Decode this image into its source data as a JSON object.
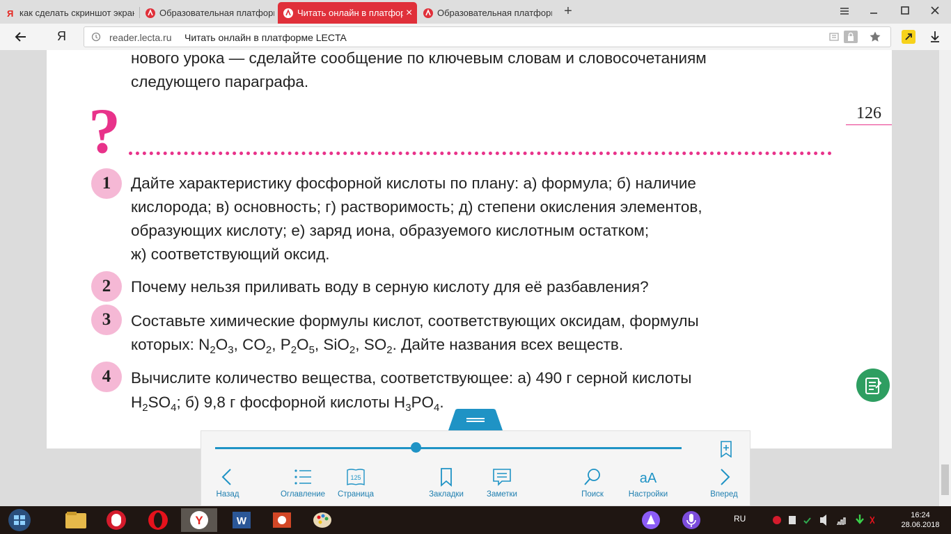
{
  "browser": {
    "tabs": [
      {
        "label": "как сделать скриншот экрана",
        "active": false
      },
      {
        "label": "Образовательная платформа",
        "active": false
      },
      {
        "label": "Читать онлайн в платформе",
        "active": true
      },
      {
        "label": "Образовательная платформа",
        "active": false
      }
    ],
    "back_icon": "arrow-left-icon",
    "yandex_logo": "Я",
    "url": "reader.lecta.ru",
    "page_title": "Читать онлайн в платформе LECTA"
  },
  "page": {
    "intro_line1": "нового урока — сделайте сообщение по ключевым словам и словосочетаниям",
    "intro_line2": "следующего параграфа.",
    "question_mark": "?",
    "page_number": "126",
    "questions": [
      {
        "num": "1",
        "lines": [
          "Дайте характеристику фосфорной кислоты по плану: а) формула; б) наличие",
          "кислорода; в) основность; г) растворимость; д) степени окисления элементов,",
          "образующих кислоту; е) заряд иона, образуемого кислотным остатком;",
          "ж) соответствующий оксид."
        ]
      },
      {
        "num": "2",
        "lines": [
          "Почему нельзя приливать воду в серную кислоту для её разбавления?"
        ]
      },
      {
        "num": "3",
        "line1": "Составьте химические формулы кислот, соответствующих оксидам, формулы",
        "line2_prefix": "которых: ",
        "formulas": [
          "N",
          "2",
          "O",
          "3",
          ", CO",
          "2",
          ", P",
          "2",
          "O",
          "5",
          ", SiO",
          "2",
          ", SO",
          "2"
        ],
        "line2_suffix": ". Дайте названия всех веществ."
      },
      {
        "num": "4",
        "line1": "Вычислите количество вещества, соответствующее: а) 490 г серной кислоты",
        "line2_parts": [
          "H",
          "2",
          "SO",
          "4",
          "; б) 9,8 г фосфорной кислоты H",
          "3",
          "PO",
          "4",
          "."
        ]
      }
    ]
  },
  "reader_toolbar": {
    "progress": 0.43,
    "buttons": [
      {
        "label": "Назад",
        "icon": "chevron-left-icon"
      },
      {
        "label": "Оглавление",
        "icon": "list-icon"
      },
      {
        "label": "Страница",
        "icon": "page-icon",
        "badge": "125"
      },
      {
        "label": "Закладки",
        "icon": "bookmark-icon"
      },
      {
        "label": "Заметки",
        "icon": "notes-icon"
      },
      {
        "label": "Поиск",
        "icon": "search-icon"
      },
      {
        "label": "Настройки",
        "icon": "text-size-icon",
        "glyph": "аА"
      },
      {
        "label": "Вперед",
        "icon": "chevron-right-icon"
      }
    ]
  },
  "taskbar": {
    "language": "RU",
    "time": "16:24",
    "date": "28.06.2018"
  },
  "colors": {
    "accent_pink": "#e8328a",
    "badge_pink": "#f5b8d5",
    "reader_blue": "#1f93c5",
    "tab_active": "#e0303a",
    "notes_green": "#2e9e61"
  }
}
